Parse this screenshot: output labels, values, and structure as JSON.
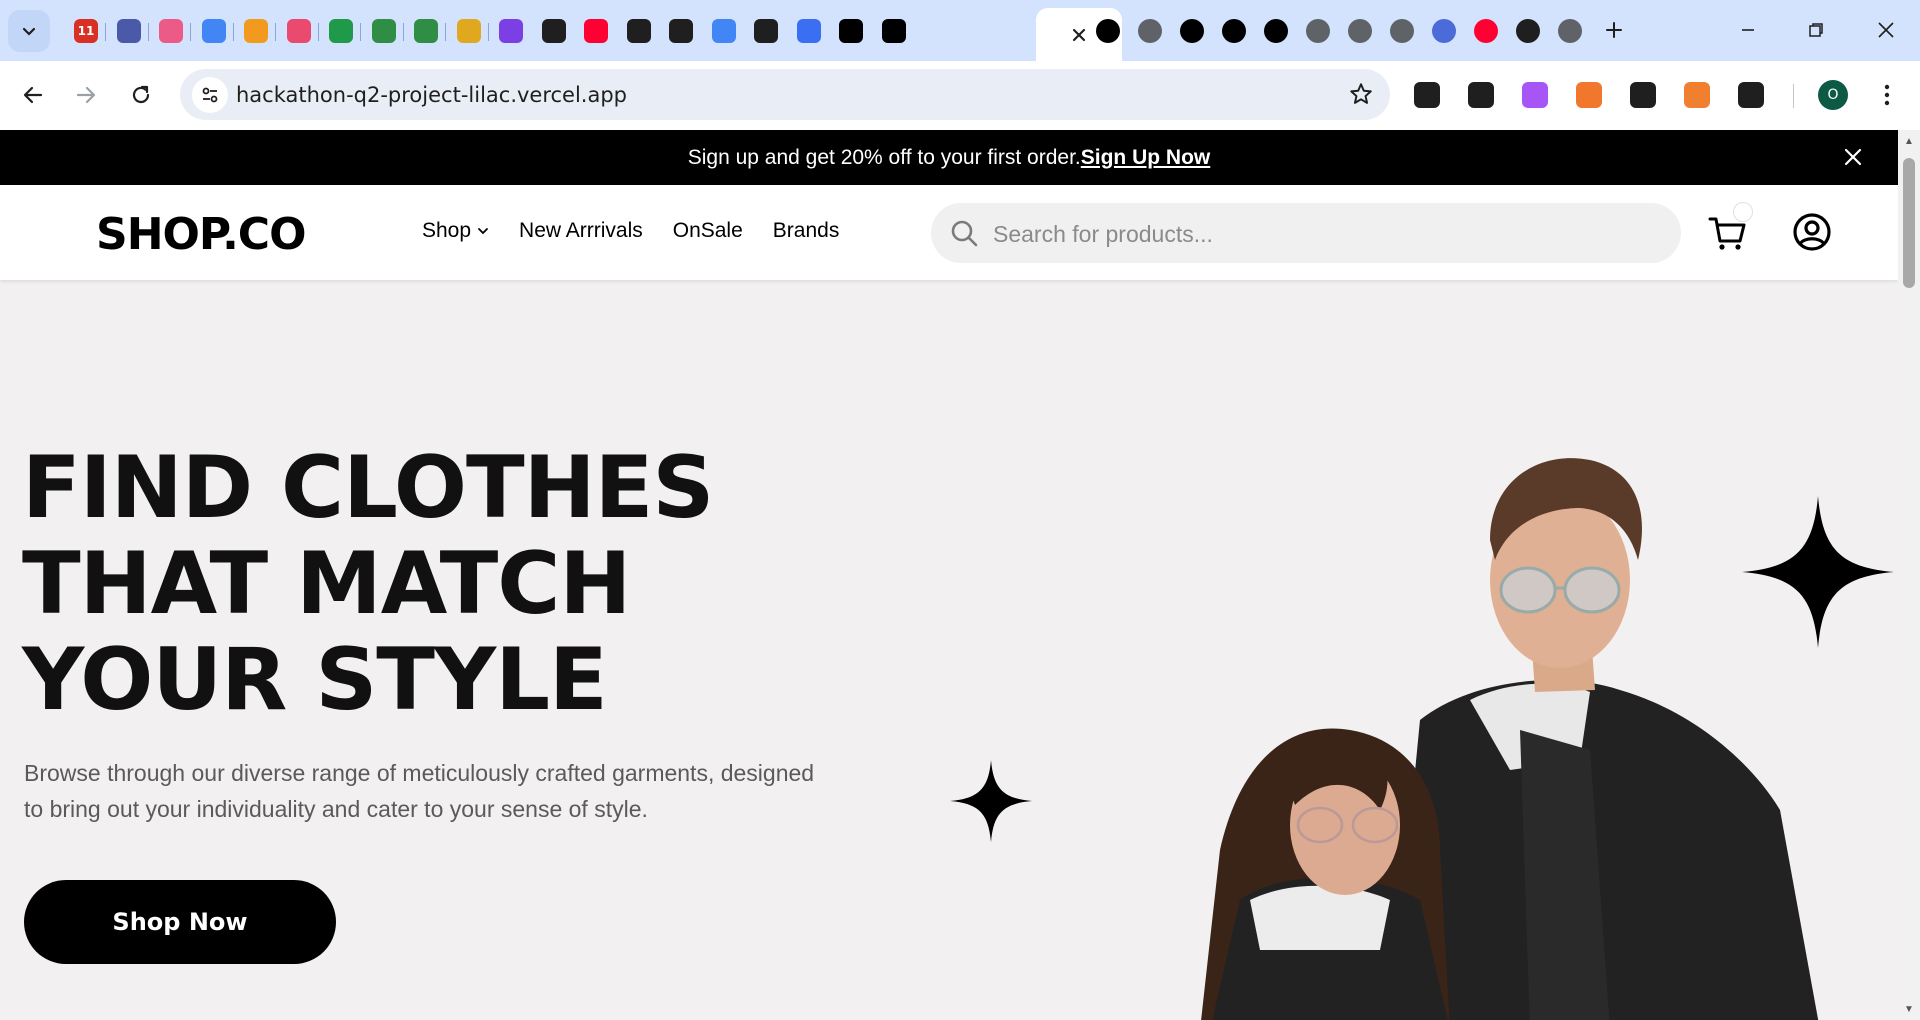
{
  "browser": {
    "tab_favicons": [
      {
        "icon": "calendar-icon",
        "label": "11",
        "color": "#d93025"
      },
      {
        "icon": "site-logo-icon",
        "label": "",
        "color": "#4a5aa8"
      },
      {
        "icon": "pink-circle-icon",
        "label": "",
        "color": "#ec5b88"
      },
      {
        "icon": "google-g-icon",
        "label": "",
        "color": "#4285f4"
      },
      {
        "icon": "infinity-icon",
        "label": "",
        "color": "#f29a1f"
      },
      {
        "icon": "glasses-icon",
        "label": "",
        "color": "#e94a6d"
      },
      {
        "icon": "green-plus-icon",
        "label": "",
        "color": "#1e9a4a"
      },
      {
        "icon": "gfg-icon",
        "label": "",
        "color": "#2f8d46"
      },
      {
        "icon": "gfg-icon",
        "label": "",
        "color": "#2f8d46"
      },
      {
        "icon": "ytn-icon",
        "label": "",
        "color": "#e0a81e"
      },
      {
        "icon": "purple-bot-icon",
        "label": "",
        "color": "#7b3fe4"
      },
      {
        "icon": "github-icon",
        "label": "",
        "color": "#1f1f1f"
      },
      {
        "icon": "youtube-icon",
        "label": "",
        "color": "#ff0033"
      },
      {
        "icon": "github-icon",
        "label": "",
        "color": "#1f1f1f"
      },
      {
        "icon": "openai-icon",
        "label": "",
        "color": "#1f1f1f"
      },
      {
        "icon": "google-icon",
        "label": "",
        "color": "#4285f4"
      },
      {
        "icon": "check-wave-icon",
        "label": "",
        "color": "#1f1f1f"
      },
      {
        "icon": "blue-bars-icon",
        "label": "",
        "color": "#3b6ff2"
      },
      {
        "icon": "v0-icon",
        "label": "",
        "color": "#000000"
      },
      {
        "icon": "vercel-triangle-icon",
        "label": "",
        "color": "#000000"
      }
    ],
    "tab_favicons_after": [
      {
        "icon": "vercel-triangle-icon",
        "color": "#000000"
      },
      {
        "icon": "globe-icon",
        "color": "#5f6368"
      },
      {
        "icon": "vercel-triangle-icon",
        "color": "#000000"
      },
      {
        "icon": "vercel-triangle-icon",
        "color": "#000000"
      },
      {
        "icon": "vercel-triangle-icon",
        "color": "#000000"
      },
      {
        "icon": "globe-icon",
        "color": "#5f6368"
      },
      {
        "icon": "globe-icon",
        "color": "#5f6368"
      },
      {
        "icon": "globe-icon",
        "color": "#5f6368"
      },
      {
        "icon": "bird-icon",
        "color": "#4a6bd8"
      },
      {
        "icon": "youtube-icon",
        "color": "#ff0033"
      },
      {
        "icon": "github-icon",
        "color": "#1f1f1f"
      },
      {
        "icon": "chrome-icon",
        "color": "#5f6368"
      }
    ],
    "url": "hackathon-q2-project-lilac.vercel.app",
    "profile_initial": "O",
    "extensions": [
      {
        "icon": "eyedropper-icon",
        "color": "#1f1f1f"
      },
      {
        "icon": "image-icon",
        "color": "#1f1f1f"
      },
      {
        "icon": "brain-icon",
        "color": "#a855f7"
      },
      {
        "icon": "notes-icon",
        "color": "#f0772c"
      },
      {
        "icon": "font-icon",
        "color": "#1f1f1f"
      },
      {
        "icon": "chess-icon",
        "color": "#f08030"
      },
      {
        "icon": "puzzle-icon",
        "color": "#1f1f1f"
      }
    ]
  },
  "promo": {
    "text": "Sign up and get 20% off to your first order.",
    "link": "Sign Up Now"
  },
  "header": {
    "logo": "SHOP.CO",
    "nav": [
      {
        "label": "Shop",
        "has_dropdown": true
      },
      {
        "label": "New Arrrivals",
        "has_dropdown": false
      },
      {
        "label": "OnSale",
        "has_dropdown": false
      },
      {
        "label": "Brands",
        "has_dropdown": false
      }
    ],
    "search_placeholder": "Search for products..."
  },
  "hero": {
    "title_lines": [
      "FIND CLOTHES",
      "THAT MATCH",
      "YOUR STYLE"
    ],
    "subtitle": "Browse through our diverse range of meticulously crafted garments, designed to bring out your individuality and cater to your sense of style.",
    "cta": "Shop Now"
  },
  "colors": {
    "accent": "#000000",
    "hero_bg": "#f2f0f1",
    "tabstrip_bg": "#d3e3fd"
  }
}
